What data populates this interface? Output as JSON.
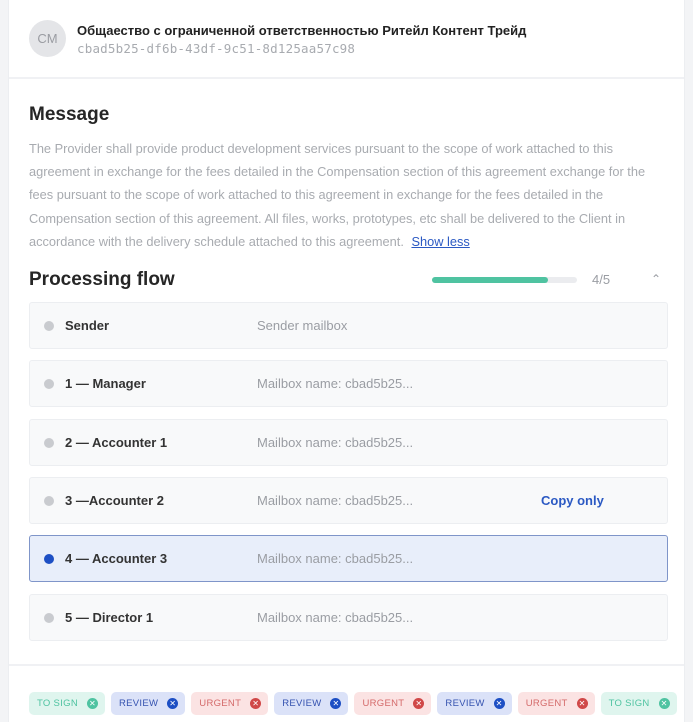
{
  "header": {
    "avatar_initials": "CM",
    "org_name": "Общаество с ограниченной ответственностью Ритейл Контент Трейд",
    "org_id": "cbad5b25-df6b-43df-9c51-8d125aa57c98"
  },
  "message": {
    "title": "Message",
    "body": "The Provider shall provide product development services pursuant to the scope of work attached to this agreement in exchange for the fees detailed in the Compensation section of this agreement exchange for the fees pursuant to the scope of work attached to this agreement in exchange for the fees detailed in the Compensation section of this agreement. All files, works, prototypes, etc shall be delivered to the Client in accordance with the delivery schedule attached to this agreement.",
    "show_less": "Show less"
  },
  "flow": {
    "title": "Processing flow",
    "progress": 0.8,
    "count": "4/5",
    "collapse_icon": "chevron-up-icon",
    "steps": [
      {
        "name": "Sender",
        "mailbox": "Sender mailbox",
        "note": "",
        "active": false
      },
      {
        "name": "1 — Manager",
        "mailbox": "Mailbox name: cbad5b25...",
        "note": "",
        "active": false
      },
      {
        "name": "2 — Accounter 1",
        "mailbox": "Mailbox name: cbad5b25...",
        "note": "",
        "active": false
      },
      {
        "name": "3 —Accounter 2",
        "mailbox": "Mailbox name: cbad5b25...",
        "note": "Copy only",
        "active": false
      },
      {
        "name": "4 — Accounter 3",
        "mailbox": "Mailbox name: cbad5b25...",
        "note": "",
        "active": true
      },
      {
        "name": "5 — Director 1",
        "mailbox": "Mailbox name: cbad5b25...",
        "note": "",
        "active": false
      }
    ]
  },
  "tags": [
    {
      "label": "TO SIGN",
      "type": "sign"
    },
    {
      "label": "REVIEW",
      "type": "review"
    },
    {
      "label": "URGENT",
      "type": "urgent"
    },
    {
      "label": "REVIEW",
      "type": "review"
    },
    {
      "label": "URGENT",
      "type": "urgent"
    },
    {
      "label": "REVIEW",
      "type": "review"
    },
    {
      "label": "URGENT",
      "type": "urgent"
    },
    {
      "label": "TO SIGN",
      "type": "sign"
    }
  ],
  "colors": {
    "accent": "#2b59c3",
    "progress": "#4fc3a1",
    "active_dot": "#1d4fc4",
    "sign": {
      "bg": "#dff5ee",
      "fg": "#4fc3a1"
    },
    "review": {
      "bg": "#dbe2f8",
      "fg": "#3553b0",
      "x": "#1d4fc4"
    },
    "urgent": {
      "bg": "#fbe3e3",
      "fg": "#d46a6a",
      "x": "#d04848"
    }
  }
}
